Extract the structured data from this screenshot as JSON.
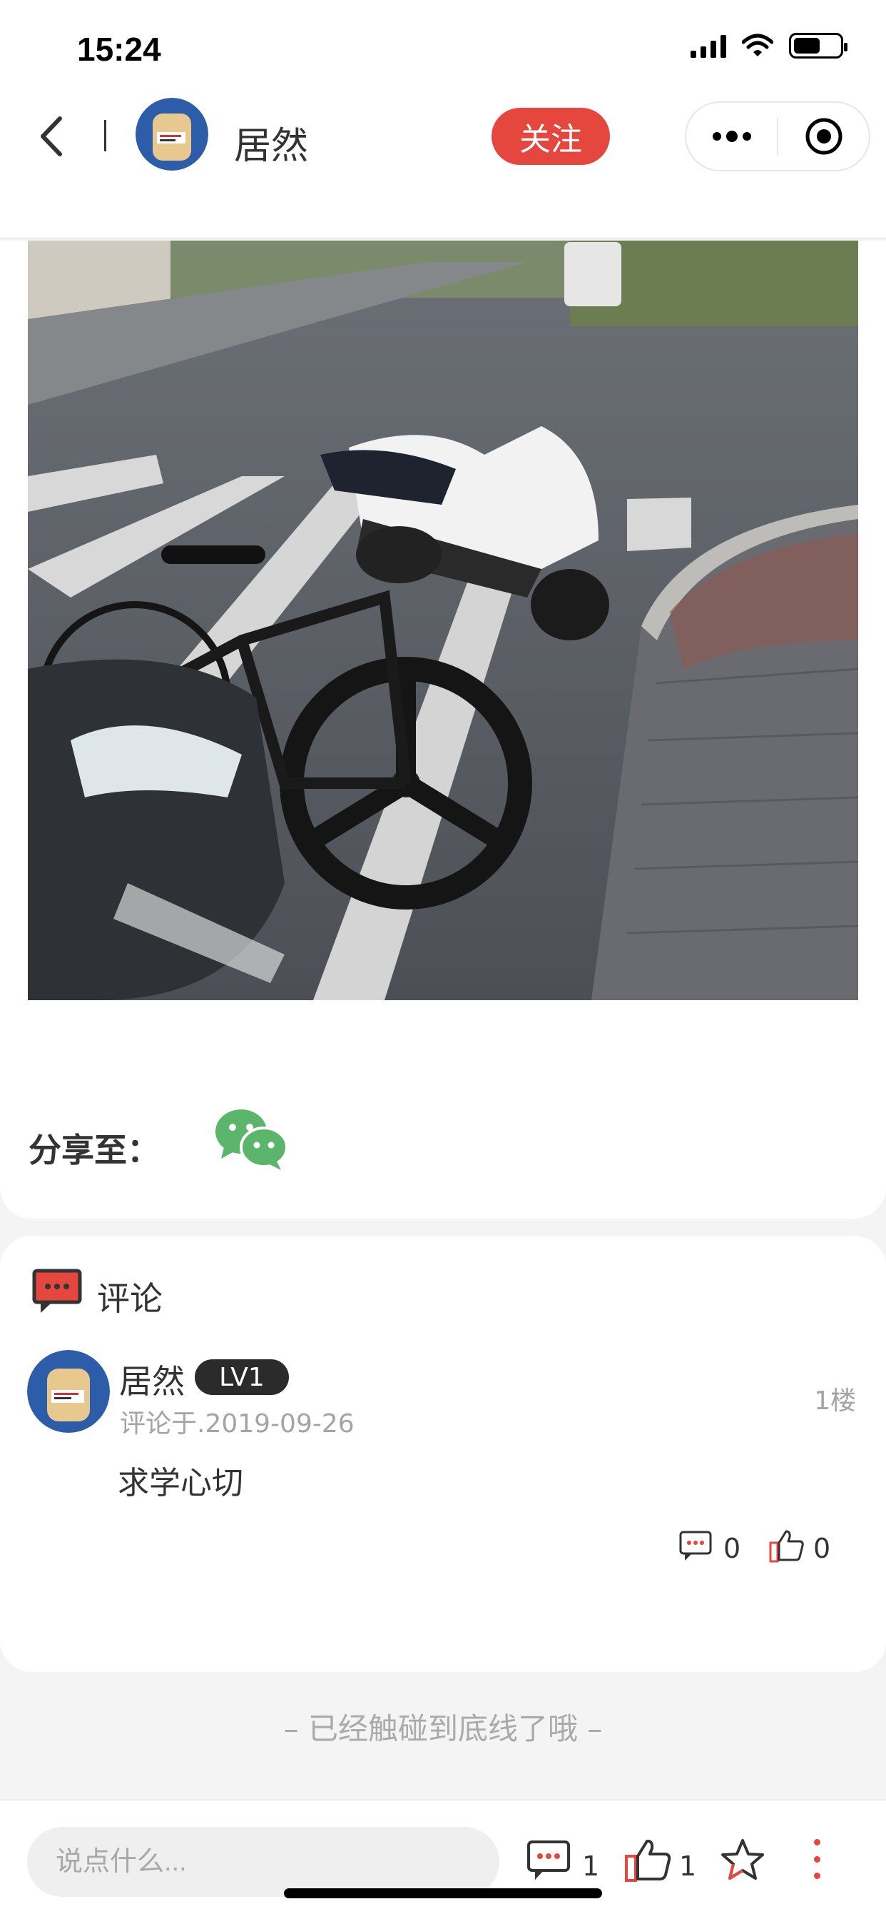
{
  "status_bar": {
    "time": "15:24"
  },
  "nav": {
    "author_name": "居然",
    "follow_label": "关注"
  },
  "post": {
    "share_label": "分享至："
  },
  "comments": {
    "section_title": "评论",
    "items": [
      {
        "author": "居然",
        "level": "LV1",
        "date": "评论于.2019-09-26",
        "floor": "1楼",
        "text": "求学心切",
        "reply_count": "0",
        "like_count": "0"
      }
    ]
  },
  "end_text": "– 已经触碰到底线了哦 –",
  "bottom_bar": {
    "input_placeholder": "说点什么...",
    "comment_count": "1",
    "like_count": "1"
  },
  "colors": {
    "accent": "#e5463d",
    "wechat": "#5bb56a",
    "badge": "#2b2b2b"
  },
  "icons": [
    "back-arrow-icon",
    "more-dots-icon",
    "target-icon",
    "wechat-icon",
    "comment-icon",
    "thumbs-up-icon",
    "star-icon",
    "vertical-more-icon"
  ]
}
